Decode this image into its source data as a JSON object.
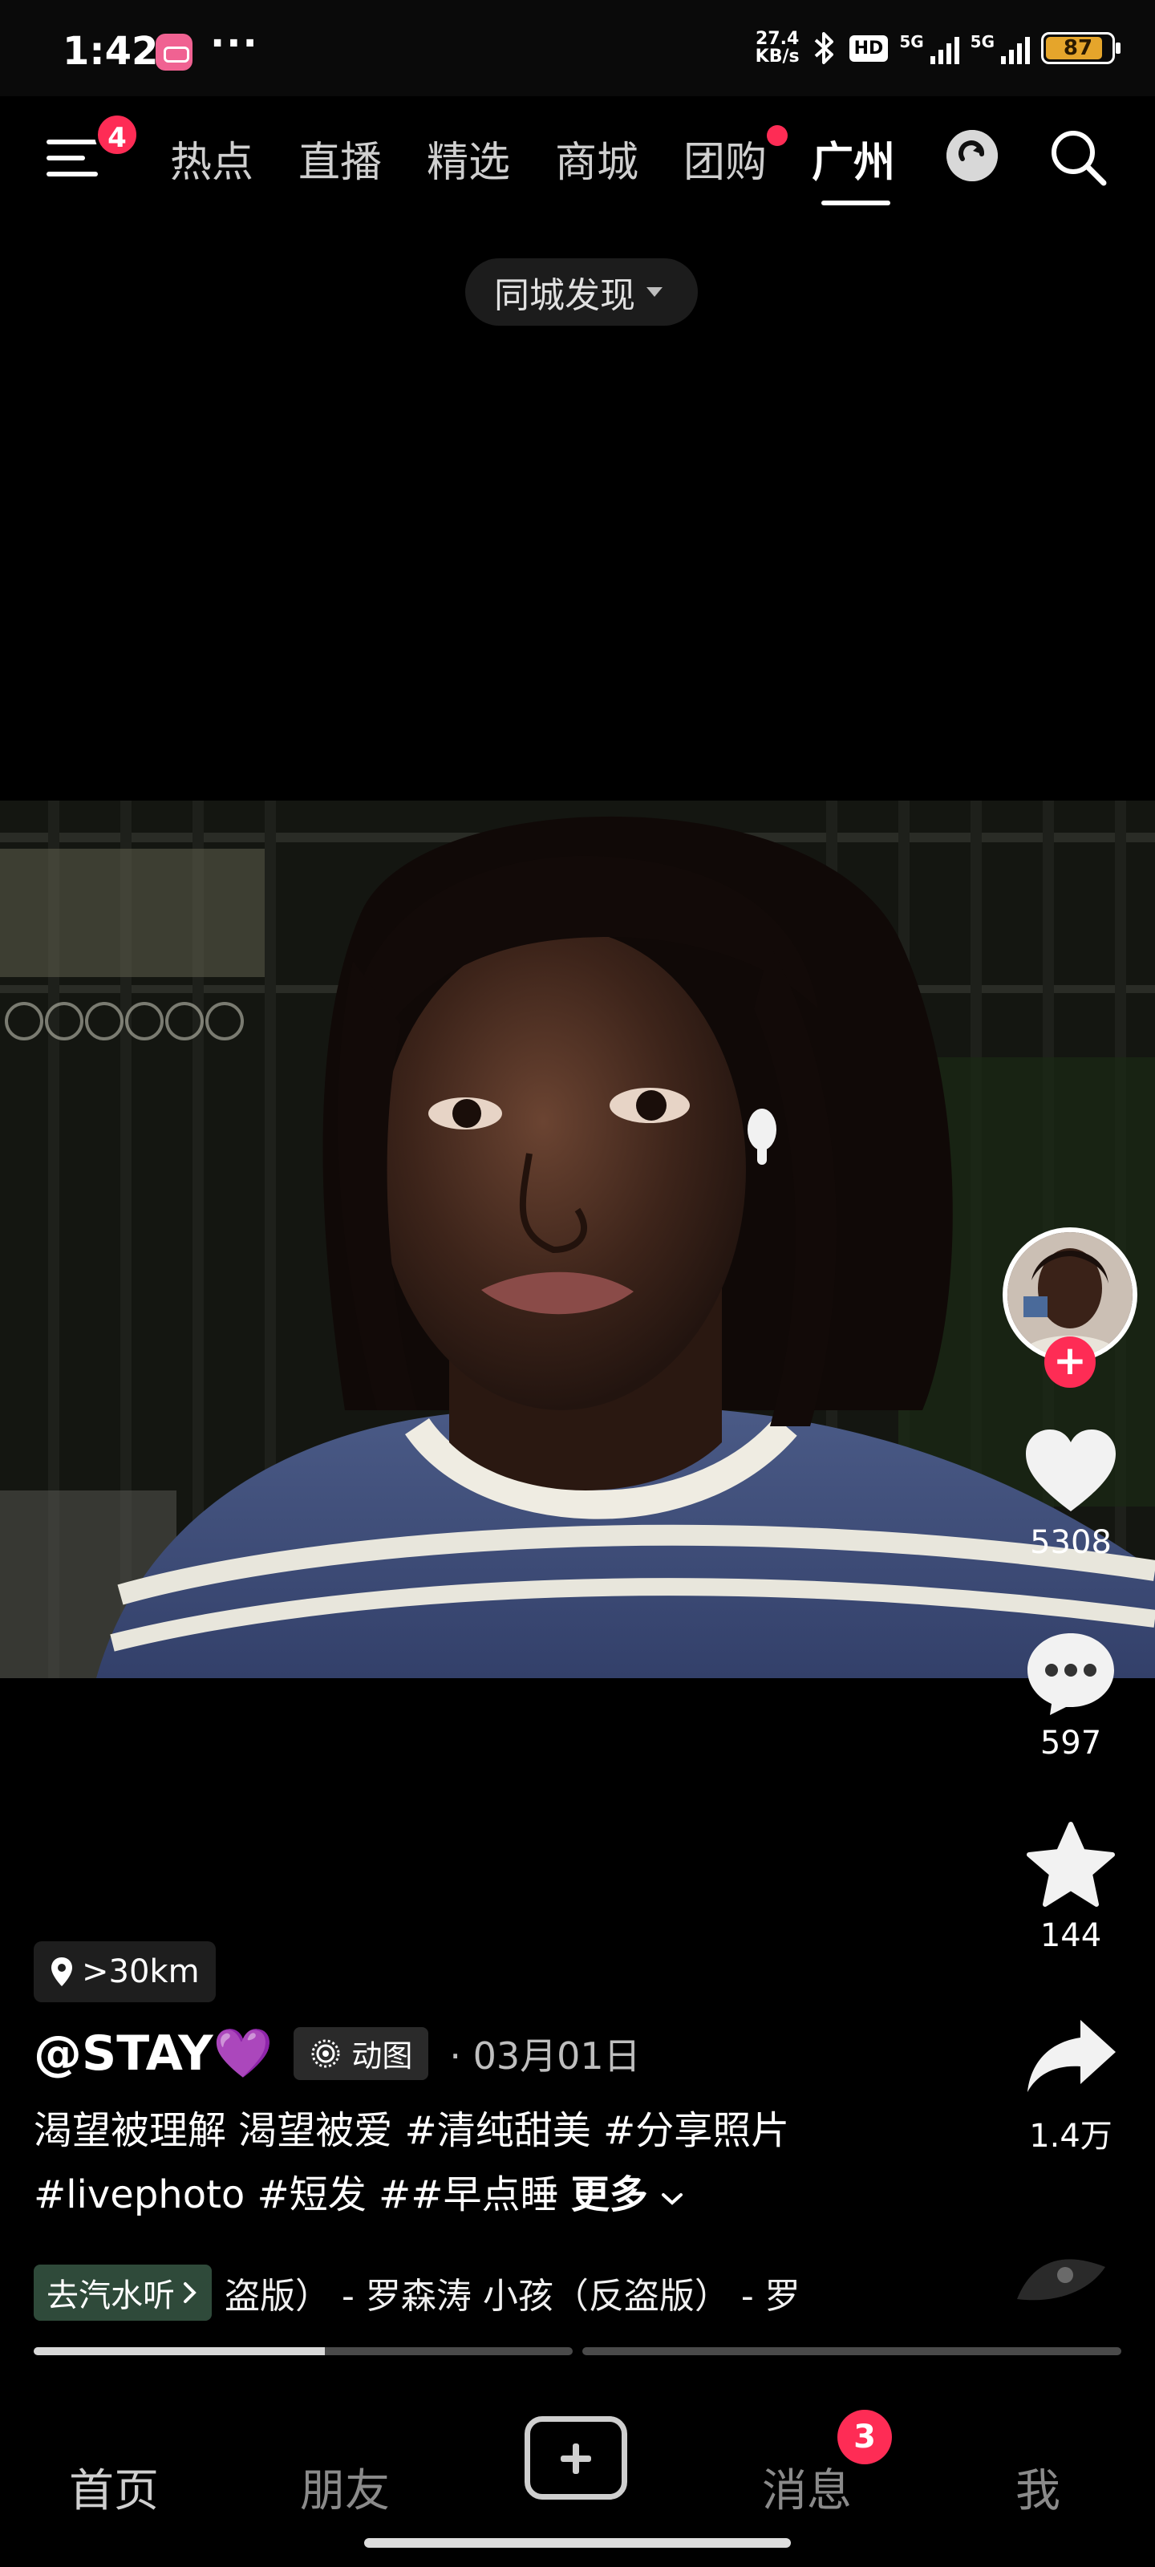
{
  "status_bar": {
    "time": "1:42",
    "more": "···",
    "net_speed_value": "27.4",
    "net_speed_unit": "KB/s",
    "hd_label": "HD",
    "sim1_label": "5G",
    "sim2_label": "5G",
    "battery_percent": "87",
    "battery_color": "#e5a52b"
  },
  "top_nav": {
    "menu_badge": "4",
    "tabs": [
      {
        "label": "热点"
      },
      {
        "label": "直播"
      },
      {
        "label": "精选"
      },
      {
        "label": "商城"
      },
      {
        "label": "团购"
      },
      {
        "label": "广州"
      }
    ],
    "active_tab": "广州",
    "dot_tab": "团购"
  },
  "city_filter": {
    "label": "同城发现"
  },
  "post": {
    "location": ">30km",
    "author": "@STAY💜",
    "motion_tag": "动图",
    "date": "· 03月01日",
    "caption_line1": "渴望被理解 渴望被爱 #清纯甜美 #分享照片",
    "caption_line2": "#livephoto #短发 ##早点睡 ",
    "caption_more": "更多",
    "music_button": "去汽水听",
    "music_text": "盗版） - 罗森涛    小孩（反盗版） - 罗",
    "progress": [
      0.54,
      0
    ]
  },
  "actions": {
    "likes": "5308",
    "comments": "597",
    "favorites": "144",
    "shares": "1.4万"
  },
  "bottom_bar": {
    "home": "首页",
    "friends": "朋友",
    "messages": "消息",
    "messages_badge": "3",
    "me": "我"
  },
  "colors": {
    "accent": "#fe2c55",
    "background": "#000000"
  }
}
